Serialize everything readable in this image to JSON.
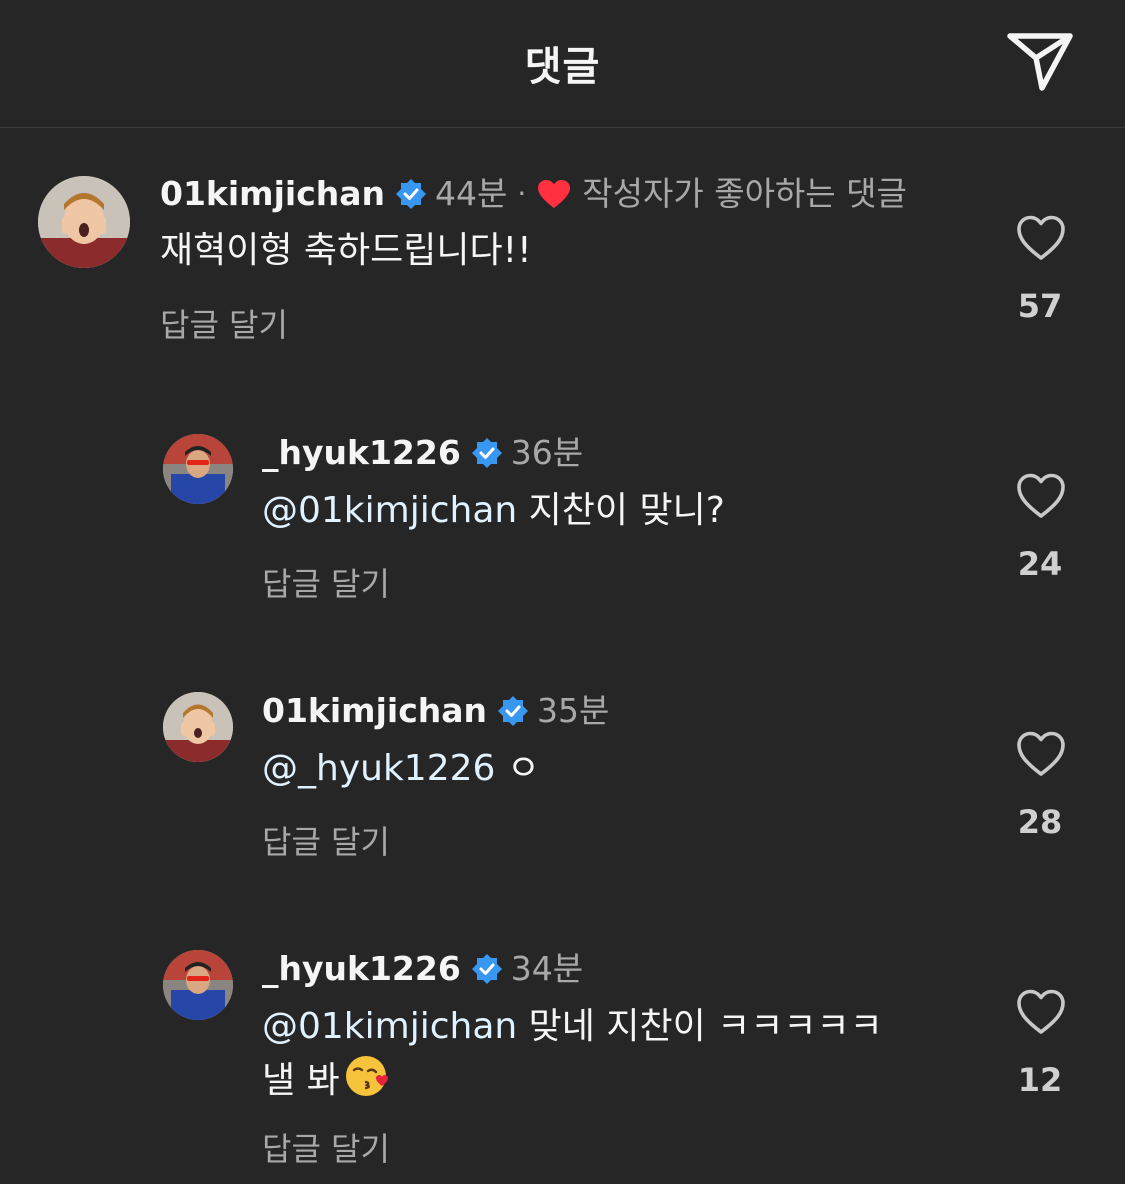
{
  "header": {
    "title": "댓글",
    "share_icon": "paper-plane-icon"
  },
  "colors": {
    "background": "#262626",
    "text": "#f5f5f5",
    "secondary_text": "#a8a8a8",
    "verified_blue": "#3897f0",
    "author_liked_heart": "#ff3040"
  },
  "comments": [
    {
      "username": "01kimjichan",
      "verified": true,
      "time": "44분",
      "separator": "·",
      "author_liked_label": "작성자가 좋아하는 댓글",
      "text": "재혁이형 축하드립니다!!",
      "reply_label": "답글 달기",
      "like_count": "57"
    },
    {
      "username": "_hyuk1226",
      "verified": true,
      "time": "36분",
      "mention": "@01kimjichan",
      "text": " 지찬이 맞니?",
      "reply_label": "답글 달기",
      "like_count": "24"
    },
    {
      "username": "01kimjichan",
      "verified": true,
      "time": "35분",
      "mention": "@_hyuk1226",
      "text": " ㅇ",
      "reply_label": "답글 달기",
      "like_count": "28"
    },
    {
      "username": "_hyuk1226",
      "verified": true,
      "time": "34분",
      "mention": "@01kimjichan",
      "text": " 맞네 지찬이 ㅋㅋㅋㅋㅋ",
      "text_line2": "낼 봐",
      "emoji": "face-blowing-a-kiss",
      "reply_label": "답글 달기",
      "like_count": "12"
    }
  ]
}
